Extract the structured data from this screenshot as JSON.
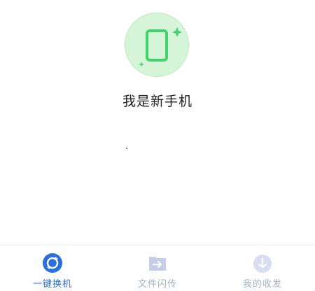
{
  "hero": {
    "title": "我是新手机",
    "icon": "phone-sparkle-icon",
    "circle_color": "#d6f5d8",
    "icon_color": "#3fd36b"
  },
  "tabs": [
    {
      "label": "一键换机",
      "icon": "sync-circle-icon",
      "active": true
    },
    {
      "label": "文件闪传",
      "icon": "file-transfer-icon",
      "active": false
    },
    {
      "label": "我的收发",
      "icon": "inbox-icon",
      "active": false
    }
  ],
  "colors": {
    "tab_active": "#2a6fe0",
    "tab_inactive": "#a9b2c2"
  }
}
